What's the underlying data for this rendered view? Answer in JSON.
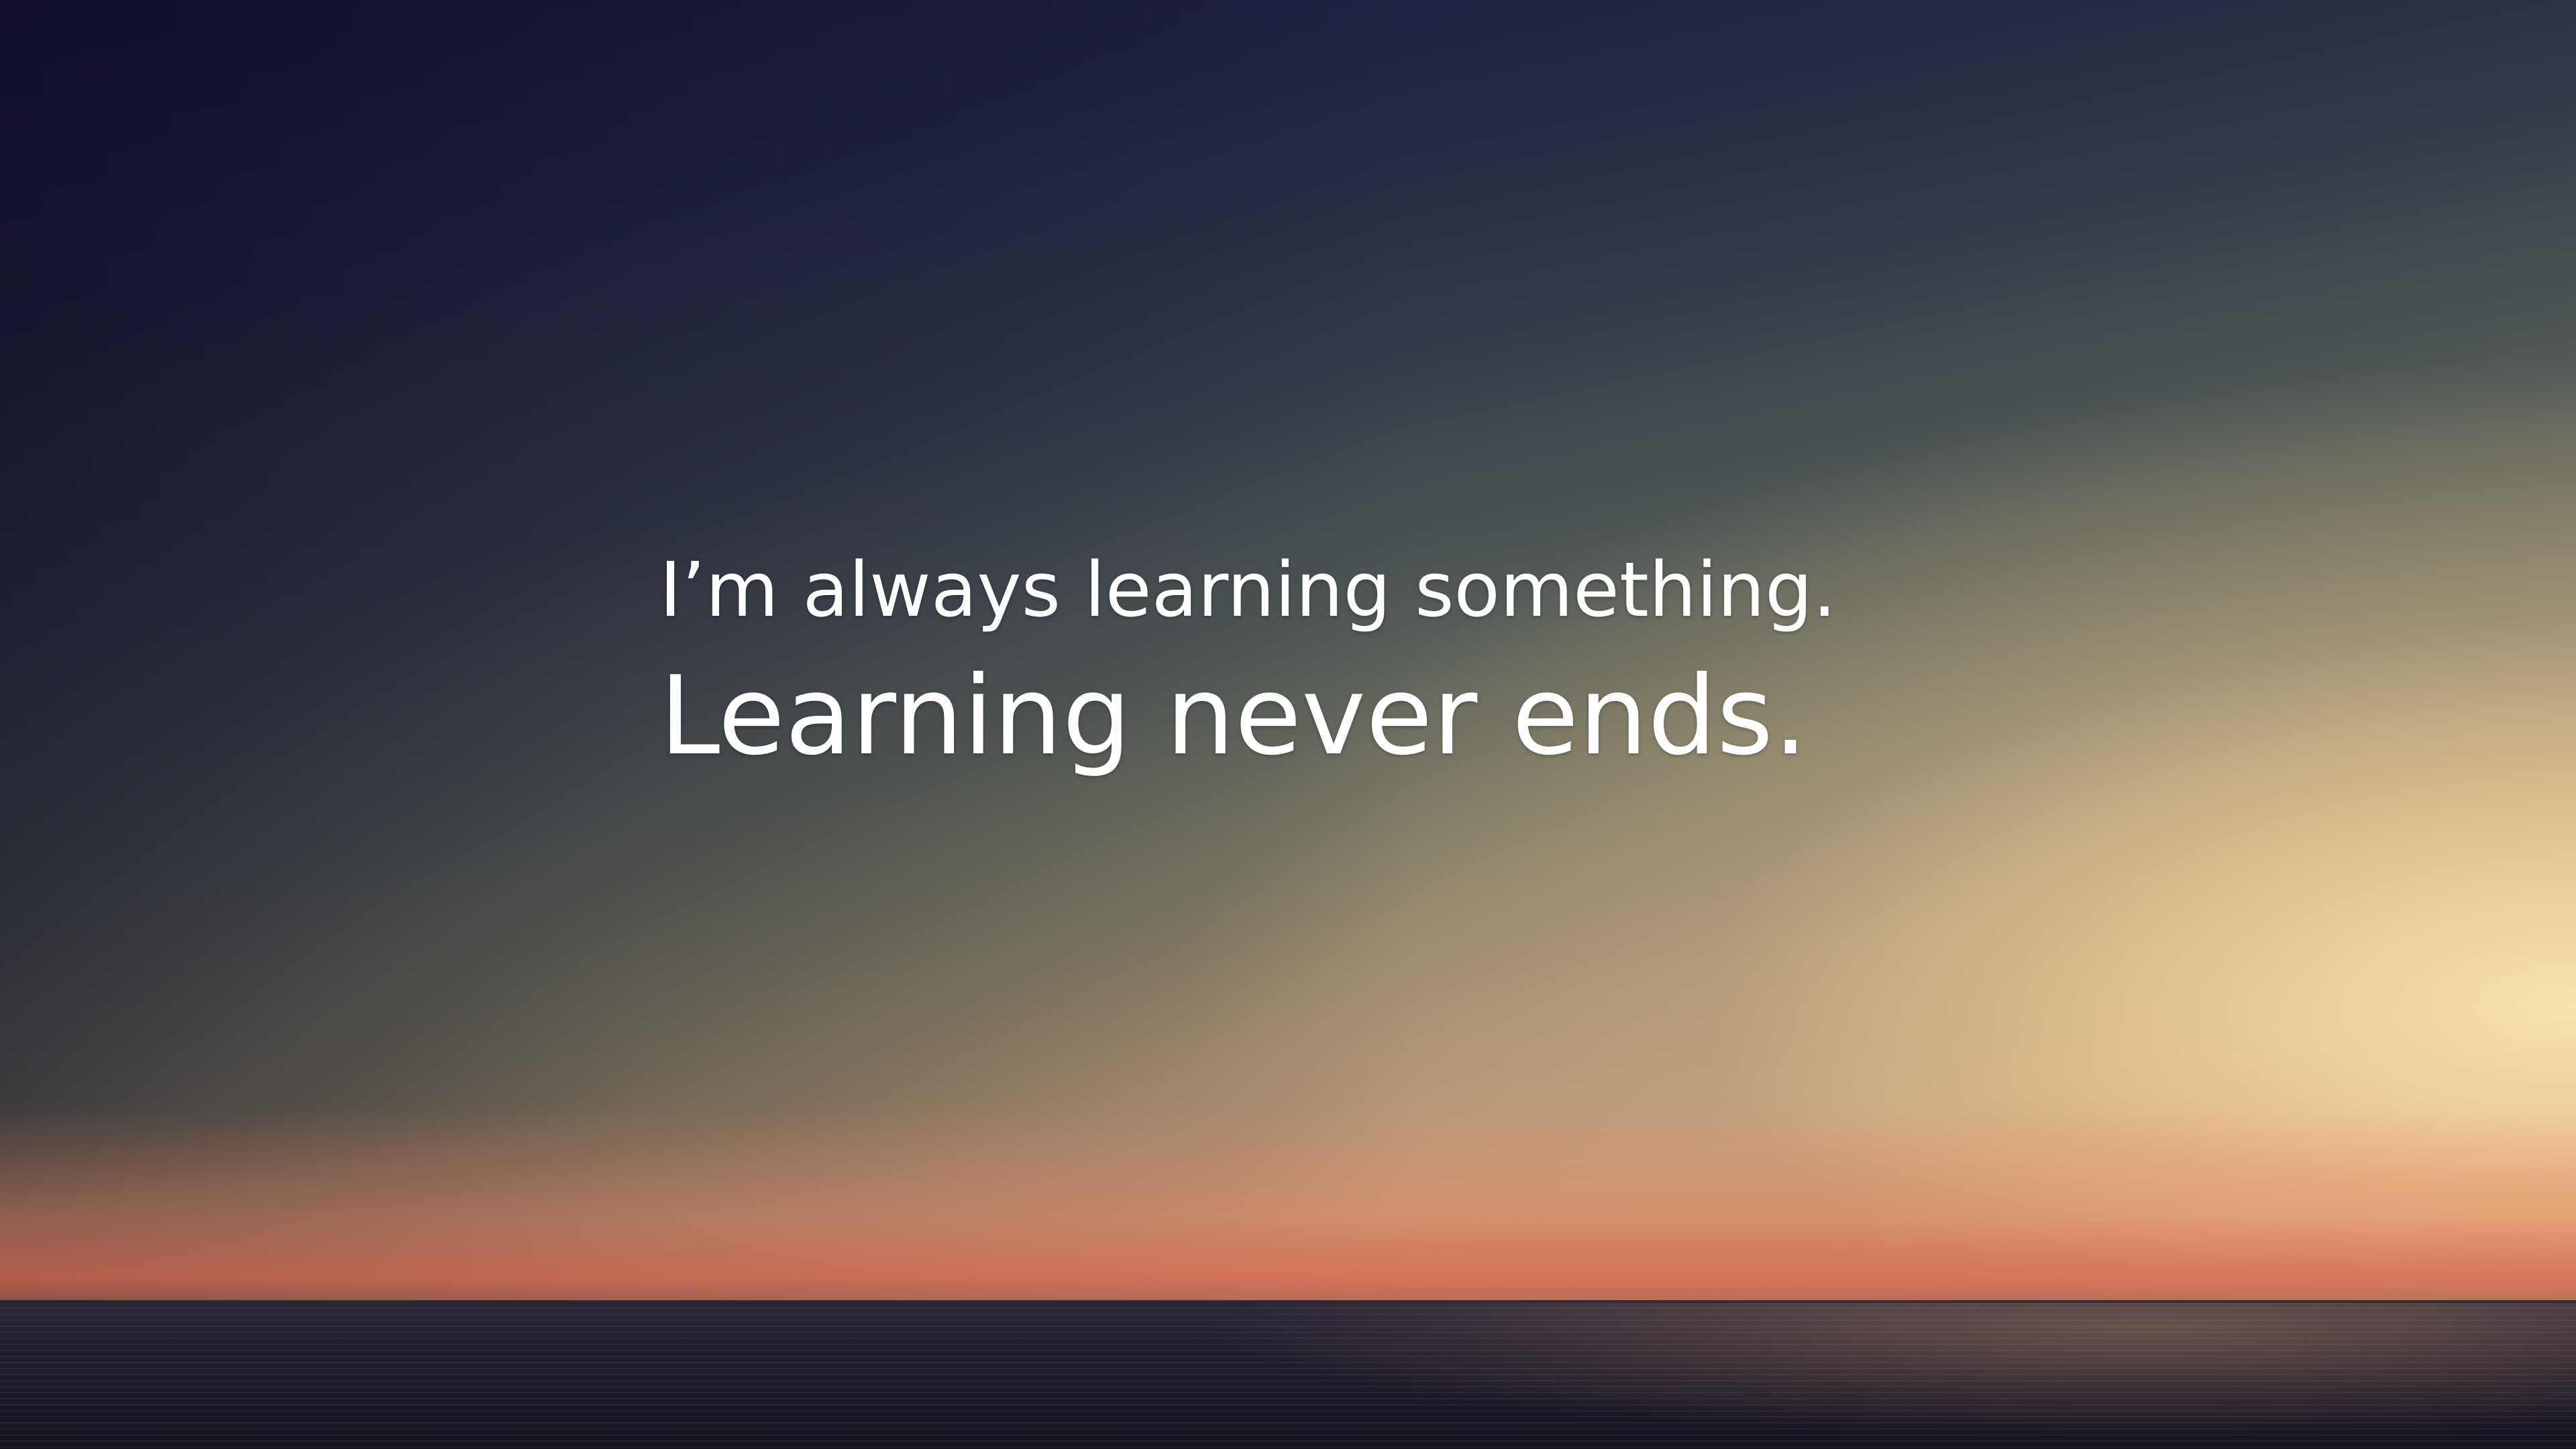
{
  "quote": {
    "line1": "I’m always learning something.",
    "line2": "Learning never ends."
  },
  "colors": {
    "sky_top": "#15153a",
    "sky_glow": "#f5e3ab",
    "horizon": "#d98866",
    "sea": "#1c1a28",
    "text": "#ffffff"
  }
}
